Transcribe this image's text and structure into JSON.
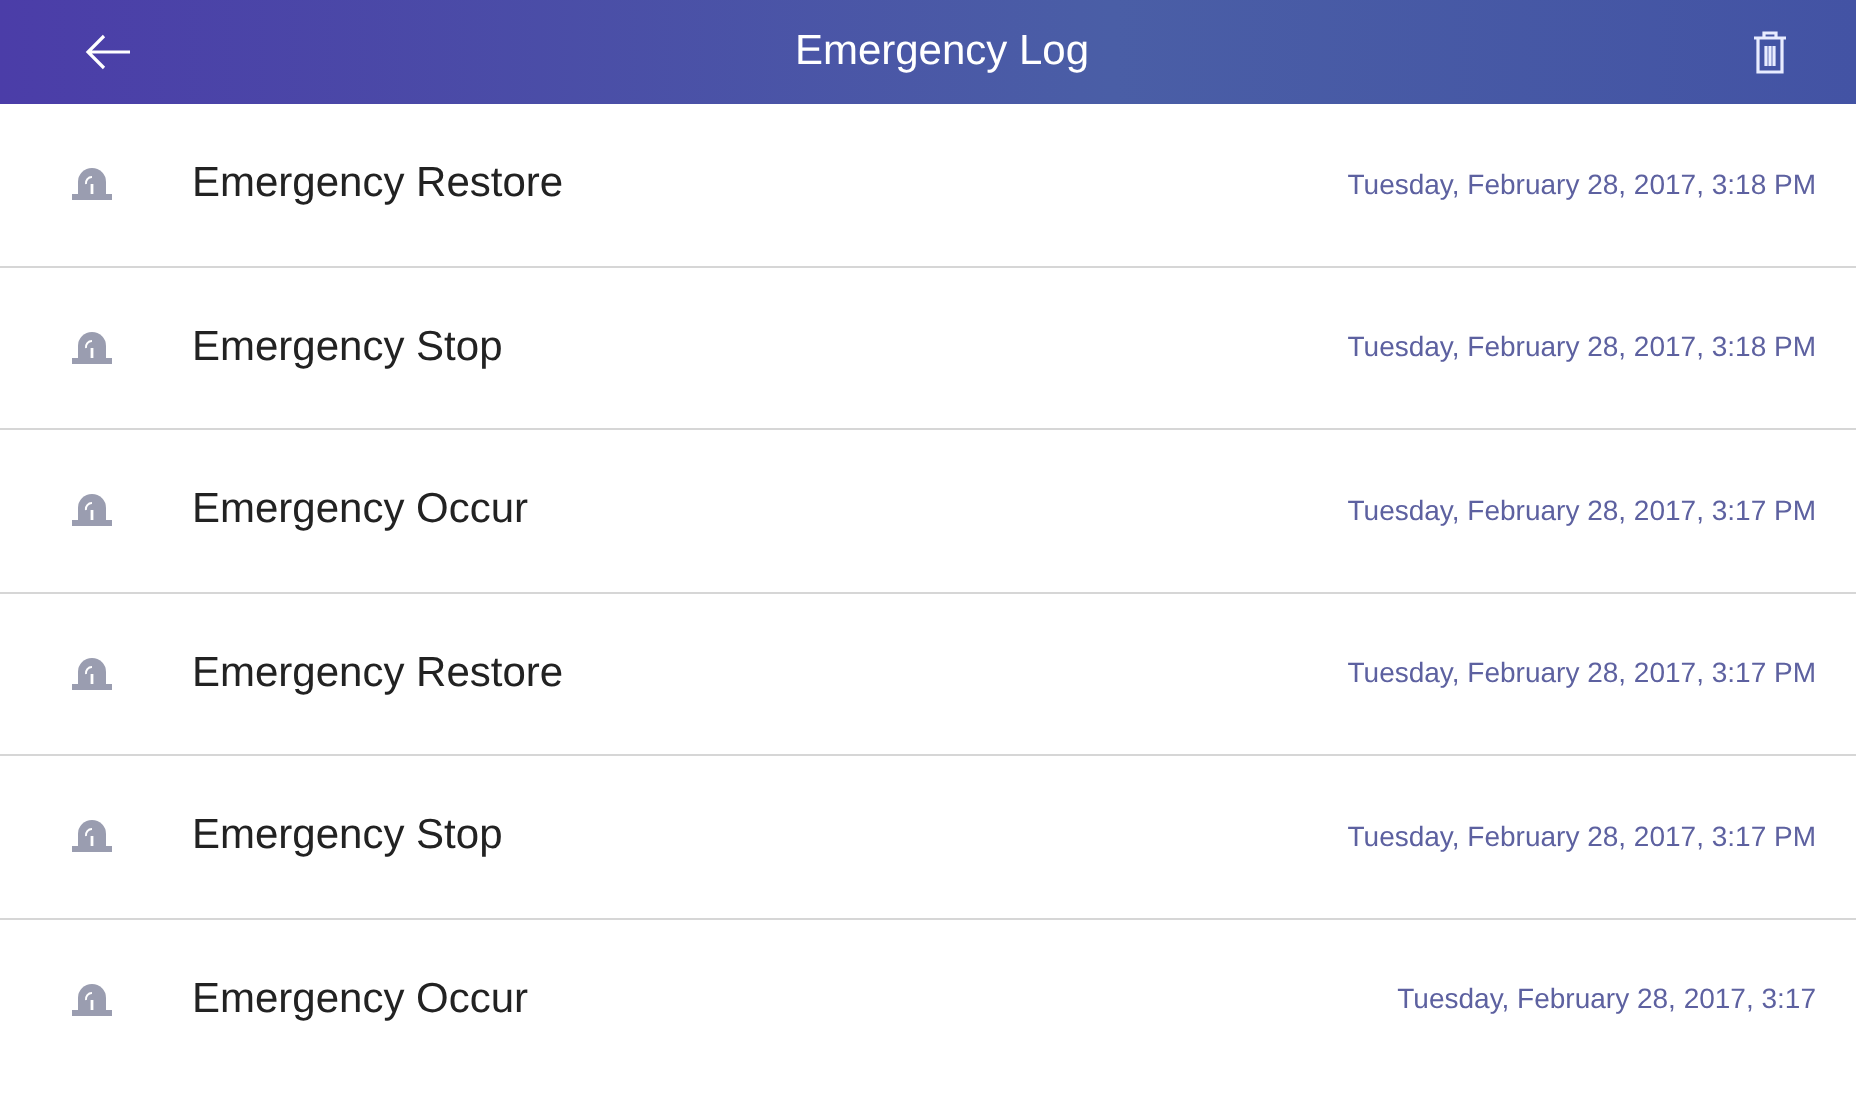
{
  "header": {
    "title": "Emergency Log"
  },
  "entries": [
    {
      "event": "Emergency Restore",
      "time": "Tuesday, February 28, 2017, 3:18 PM"
    },
    {
      "event": "Emergency Stop",
      "time": "Tuesday, February 28, 2017, 3:18 PM"
    },
    {
      "event": "Emergency Occur",
      "time": "Tuesday, February 28, 2017, 3:17 PM"
    },
    {
      "event": "Emergency Restore",
      "time": "Tuesday, February 28, 2017, 3:17 PM"
    },
    {
      "event": "Emergency Stop",
      "time": "Tuesday, February 28, 2017, 3:17 PM"
    },
    {
      "event": "Emergency Occur",
      "time": "Tuesday, February 28, 2017, 3:17"
    }
  ]
}
